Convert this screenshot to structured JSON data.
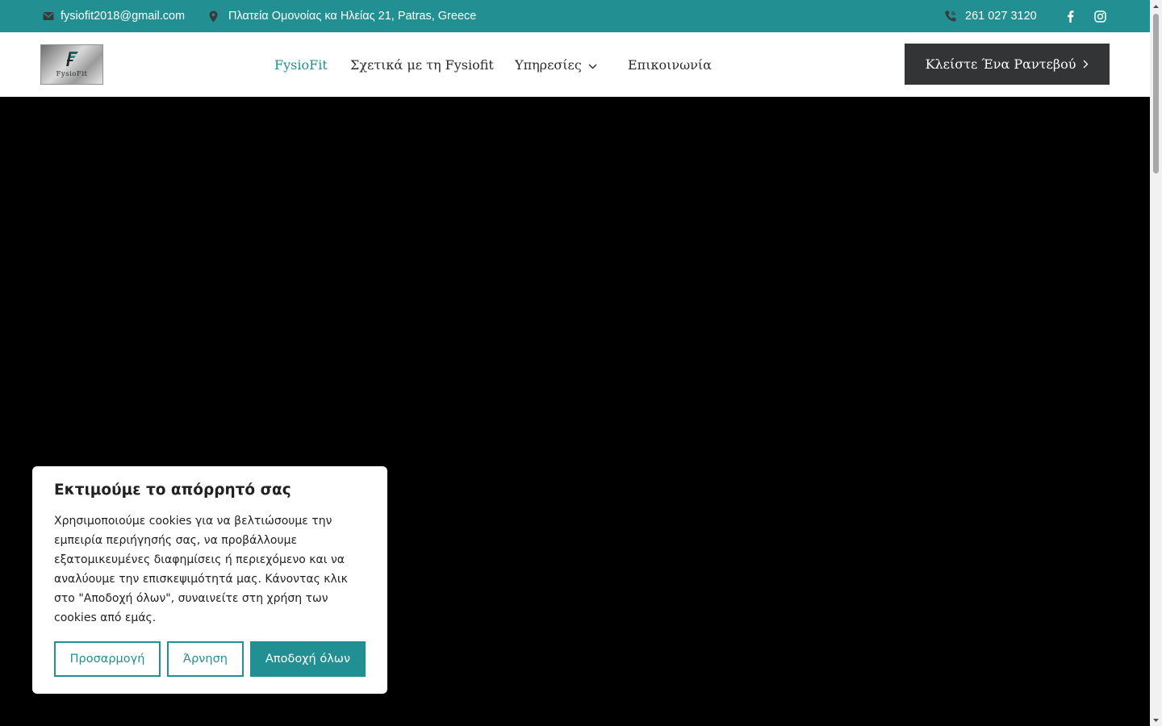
{
  "topbar": {
    "email": "fysiofit2018@gmail.com",
    "address": "Πλατεία Ομονοίας κα Ηλείας 21, Patras, Greece",
    "phone": "261 027 3120",
    "icons": [
      "envelope-icon",
      "map-pin-icon",
      "phone-icon",
      "facebook-icon",
      "instagram-icon"
    ],
    "background_color": "#228f92"
  },
  "header": {
    "logo_text": "FysioFit",
    "nav": [
      {
        "label": "FysioFit",
        "active": true
      },
      {
        "label": "Σχετικά με τη Fysiofit"
      },
      {
        "label": "Υπηρεσίες",
        "has_dropdown": true
      },
      {
        "label": "Επικοινωνία"
      }
    ],
    "cta_label": "Κλείστε Ένα Ραντεβού",
    "accent_color": "#228f92",
    "cta_color": "#333435"
  },
  "cookie_banner": {
    "title": "Εκτιμούμε το απόρρητό σας",
    "body": "Χρησιμοποιούμε cookies για να βελτιώσουμε την εμπειρία περιήγησής σας, να προβάλλουμε εξατομικευμένες διαφημίσεις ή περιεχόμενο και να αναλύουμε την επισκεψιμότητά μας. Κάνοντας κλικ στο \"Αποδοχή όλων\", συναινείτε στη χρήση των cookies από εμάς.",
    "buttons": {
      "customize": "Προσαρμογή",
      "reject": "Άρνηση",
      "accept": "Αποδοχή όλων"
    }
  }
}
